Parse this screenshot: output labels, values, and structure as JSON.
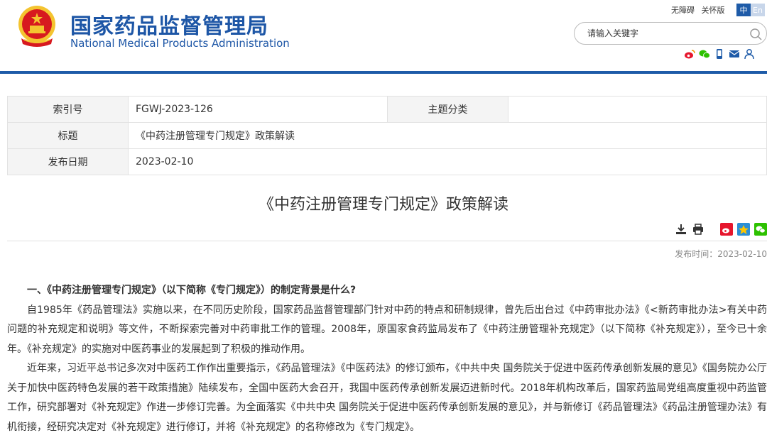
{
  "header": {
    "title": "国家药品监督管理局",
    "subtitle": "National Medical Products Administration",
    "accessibility_link": "无障碍",
    "elder_link": "关怀版",
    "lang_zh": "中",
    "lang_en": "En",
    "search_placeholder": "请输入关键字",
    "social_icons": [
      "weibo-icon",
      "wechat-icon",
      "mobile-icon",
      "mail-icon",
      "user-icon"
    ]
  },
  "meta": {
    "index_label": "索引号",
    "index_value": "FGWJ-2023-126",
    "category_label": "主题分类",
    "category_value": "",
    "title_label": "标题",
    "title_value": "《中药注册管理专门规定》政策解读",
    "date_label": "发布日期",
    "date_value": "2023-02-10"
  },
  "article": {
    "title": "《中药注册管理专门规定》政策解读",
    "publish_time": "发布时间：2023-02-10",
    "tools": [
      "download-icon",
      "print-icon",
      "share-weibo-icon",
      "share-qzone-icon",
      "share-wechat-icon"
    ],
    "heading1": "一、《中药注册管理专门规定》（以下简称《专门规定》）的制定背景是什么?",
    "para1": "自1985年《药品管理法》实施以来，在不同历史阶段，国家药品监督管理部门针对中药的特点和研制规律，曾先后出台过《中药审批办法》《<新药审批办法>有关中药问题的补充规定和说明》等文件，不断探索完善对中药审批工作的管理。2008年，原国家食药监局发布了《中药注册管理补充规定》（以下简称《补充规定》），至今已十余年。《补充规定》的实施对中医药事业的发展起到了积极的推动作用。",
    "para2": "近年来，习近平总书记多次对中医药工作作出重要指示，《药品管理法》《中医药法》的修订颁布，《中共中央 国务院关于促进中医药传承创新发展的意见》《国务院办公厅关于加快中医药特色发展的若干政策措施》陆续发布，全国中医药大会召开，我国中医药传承创新发展迈进新时代。2018年机构改革后，国家药监局党组高度重视中药监管工作，研究部署对《补充规定》作进一步修订完善。为全面落实《中共中央 国务院关于促进中医药传承创新发展的意见》，并与新修订《药品管理法》《药品注册管理办法》有机衔接，经研究决定对《补充规定》进行修订，并将《补充规定》的名称修改为《专门规定》。"
  },
  "colors": {
    "brand_blue": "#1d56a6",
    "header_bar": "#1e5ba8",
    "emblem_red": "#d7191f",
    "emblem_gold": "#f4c430"
  }
}
